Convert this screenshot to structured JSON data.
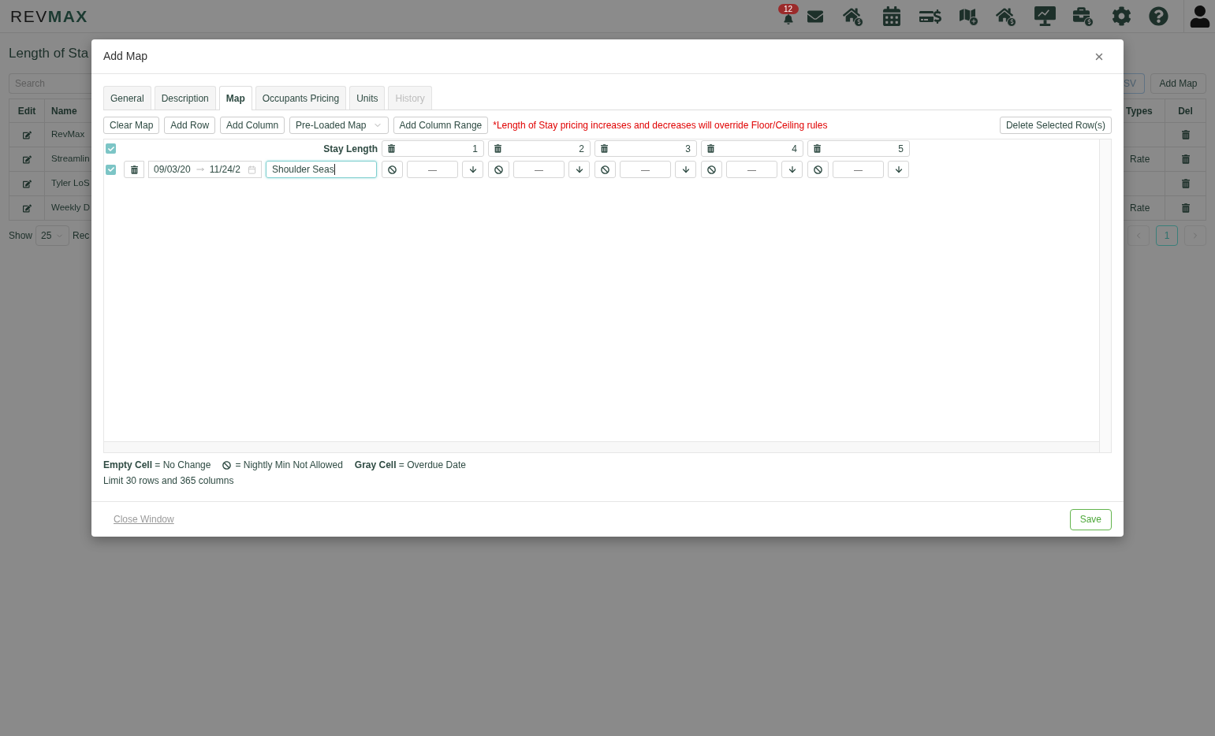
{
  "header": {
    "logo": {
      "light": "REV",
      "bold": "MAX"
    },
    "notification_count": "12"
  },
  "background_page": {
    "title": "Length of Sta",
    "search": {
      "placeholder": "Search"
    },
    "buttons": [
      "SV",
      "Add Map"
    ],
    "table": {
      "columns": [
        "Edit",
        "Name",
        "Types",
        "Del"
      ],
      "rows": [
        {
          "name": "RevMax"
        },
        {
          "name": "Streamlin",
          "types": "Rate"
        },
        {
          "name": "Tyler LoS"
        },
        {
          "name": "Weekly D",
          "types": "Rate"
        }
      ]
    },
    "page_size": {
      "label": "Show",
      "value": "25",
      "after": "Rec"
    },
    "pagination": [
      {
        "label": "1",
        "selected": true
      }
    ]
  },
  "modal": {
    "title": "Add Map",
    "tabs": [
      {
        "label": "General",
        "selected": false,
        "disabled": false
      },
      {
        "label": "Description",
        "selected": false,
        "disabled": false
      },
      {
        "label": "Map",
        "selected": true,
        "disabled": false
      },
      {
        "label": "Occupants Pricing",
        "selected": false,
        "disabled": false
      },
      {
        "label": "Units",
        "selected": false,
        "disabled": false
      },
      {
        "label": "History",
        "selected": false,
        "disabled": true
      }
    ],
    "toolbar": {
      "buttons": [
        {
          "label": "Clear Map",
          "kind": "button"
        },
        {
          "label": "Add Row",
          "kind": "button"
        },
        {
          "label": "Add Column",
          "kind": "button"
        },
        {
          "label": "Pre-Loaded Map",
          "kind": "dropdown"
        },
        {
          "label": "Add Column Range",
          "kind": "button"
        }
      ],
      "warning": "*Length of Stay pricing increases and decreases will override Floor/Ceiling rules",
      "delete_button": "Delete Selected Row(s)"
    },
    "grid": {
      "header": {
        "checked": true,
        "label": "Stay Length",
        "columns": [
          "1",
          "2",
          "3",
          "4",
          "5"
        ]
      },
      "rows": [
        {
          "checked": true,
          "start_date": "09/03/20",
          "end_date": "11/24/2",
          "name": {
            "value": "Shoulder Seas",
            "focused": true
          },
          "cells": [
            {
              "value": "—"
            },
            {
              "value": "—"
            },
            {
              "value": "—"
            },
            {
              "value": "—"
            },
            {
              "value": "—"
            }
          ]
        }
      ]
    },
    "legend": [
      {
        "kind": "text",
        "text": "**Empty Cell** = No Change"
      },
      {
        "kind": "icon",
        "text": "= Nightly Min Not Allowed"
      },
      {
        "kind": "text",
        "text": "**Gray Cell** = Overdue Date"
      }
    ],
    "limit_note": "Limit 30 rows and 365 columns",
    "footer": {
      "close_link": "Close Window",
      "save_button": "Save"
    }
  }
}
